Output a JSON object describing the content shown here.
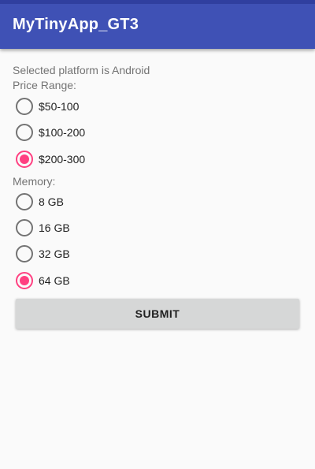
{
  "app_bar": {
    "title": "MyTinyApp_GT3",
    "color": "#3f51b5"
  },
  "info": {
    "selected_platform_text": "Selected platform is Android"
  },
  "price_range": {
    "label": "Price Range:",
    "options": [
      {
        "label": "$50-100",
        "checked": false
      },
      {
        "label": "$100-200",
        "checked": false
      },
      {
        "label": "$200-300",
        "checked": true
      }
    ]
  },
  "memory": {
    "label": "Memory:",
    "options": [
      {
        "label": "8 GB",
        "checked": false
      },
      {
        "label": "16 GB",
        "checked": false
      },
      {
        "label": "32 GB",
        "checked": false
      },
      {
        "label": "64 GB",
        "checked": true
      }
    ]
  },
  "submit": {
    "label": "SUBMIT"
  },
  "colors": {
    "accent": "#ff4081",
    "primary": "#3f51b5"
  }
}
